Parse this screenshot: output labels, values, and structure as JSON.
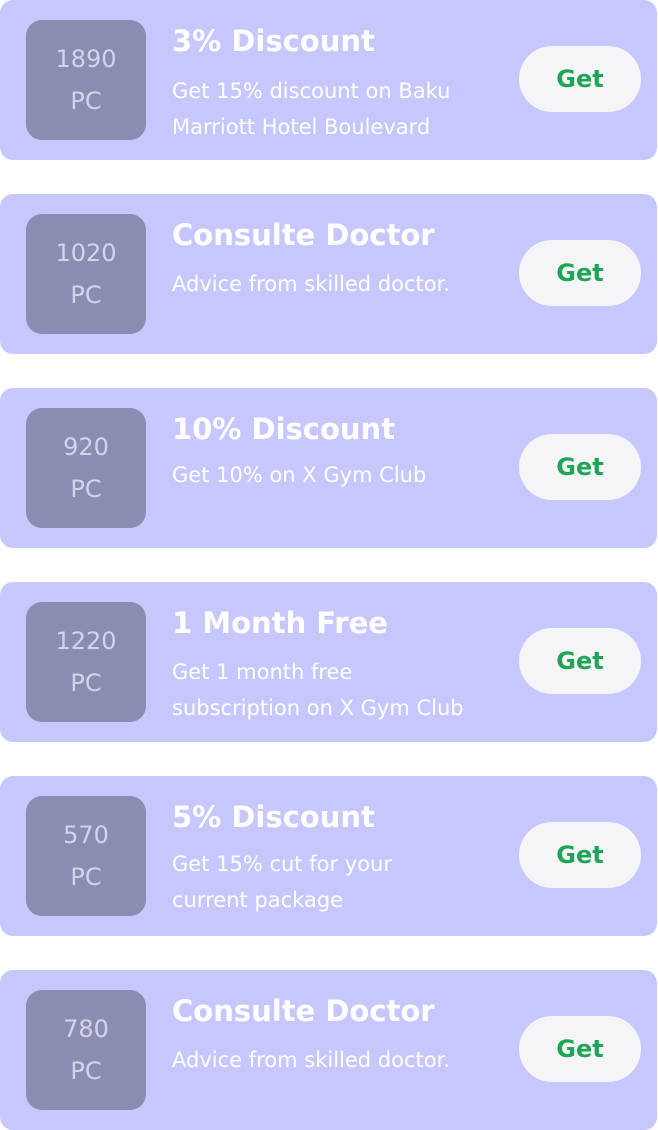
{
  "offers": [
    {
      "points": "1890",
      "unit": "PC",
      "title": "3% Discount",
      "description": [
        "Get 15% discount on Baku",
        "Marriott Hotel Boulevard"
      ],
      "button": "Get"
    },
    {
      "points": "1020",
      "unit": "PC",
      "title": "Consulte Doctor",
      "description": [
        "Advice from skilled doctor."
      ],
      "button": "Get"
    },
    {
      "points": "920",
      "unit": "PC",
      "title": "10% Discount",
      "description": [
        "Get 10% on X Gym Club"
      ],
      "button": "Get"
    },
    {
      "points": "1220",
      "unit": "PC",
      "title": "1 Month Free",
      "description": [
        "Get 1 month free",
        "subscription on X Gym Club"
      ],
      "button": "Get"
    },
    {
      "points": "570",
      "unit": "PC",
      "title": "5% Discount",
      "description": [
        "Get 15% cut for your",
        "current package"
      ],
      "button": "Get"
    },
    {
      "points": "780",
      "unit": "PC",
      "title": "Consulte Doctor",
      "description": [
        "Advice from skilled doctor."
      ],
      "button": "Get"
    }
  ],
  "colors": {
    "card_background": "#c6c8fd",
    "badge_background": "#8b8cb1",
    "badge_text": "#d3d4ec",
    "button_background": "#f5f5f8",
    "button_text": "#20a455",
    "text": "#ffffff"
  }
}
